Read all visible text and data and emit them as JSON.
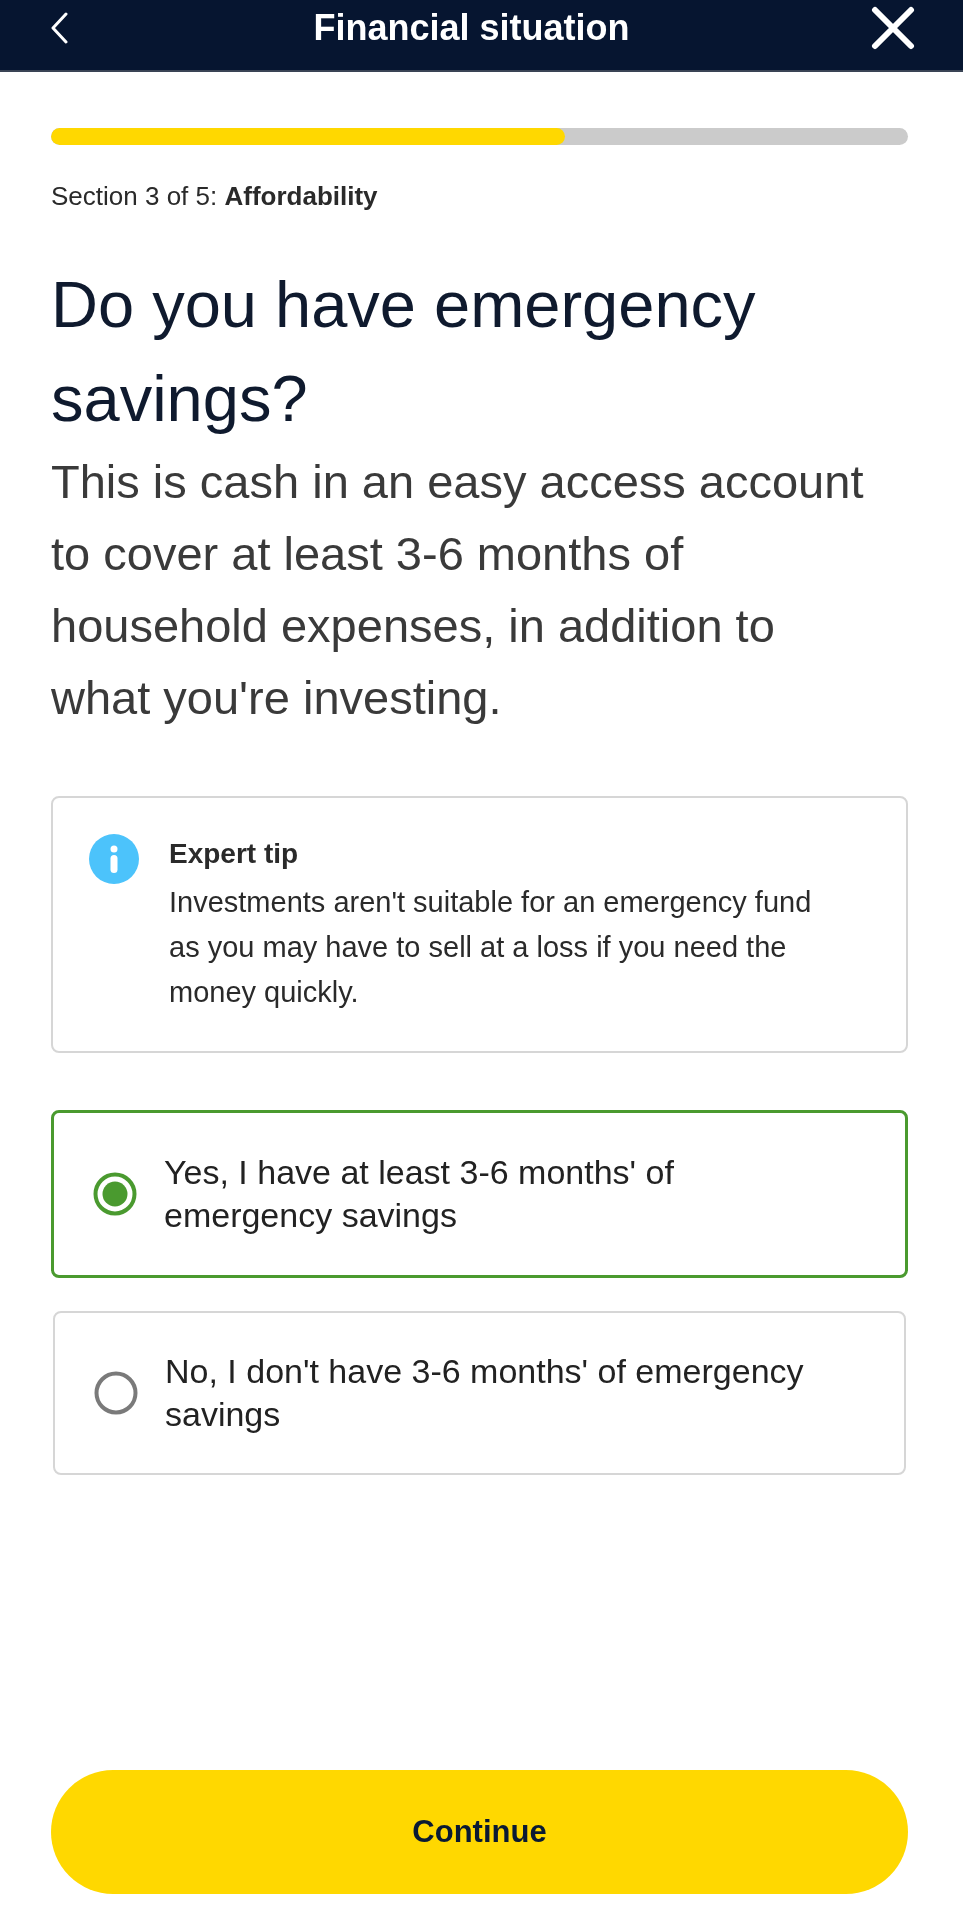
{
  "header": {
    "title": "Financial situation"
  },
  "progress": {
    "level": 0.6
  },
  "section": {
    "label": "Section 3 of 5: **Affordability**"
  },
  "question": {
    "title": "Do you have emergency savings?",
    "description": "This is cash in an easy access account to cover at least 3-6 months of household expenses, in addition to what you're investing."
  },
  "tip": {
    "title": "Expert tip",
    "text": "Investments aren't suitable for an emergency fund as you may have to sell at a loss if you need the money quickly."
  },
  "options": [
    {
      "label": "Yes, I have at least 3-6 months' of emergency savings",
      "selected": true
    },
    {
      "label": "No, I don't have 3-6 months' of emergency savings",
      "selected": false
    }
  ],
  "continue_button": {
    "label": "Continue"
  }
}
